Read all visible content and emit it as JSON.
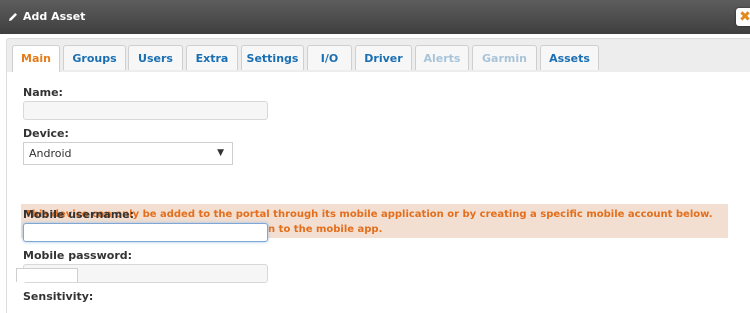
{
  "window": {
    "title": "Add Asset",
    "close_icon": "close-icon"
  },
  "tabs": [
    {
      "label": "Main",
      "state": "active"
    },
    {
      "label": "Groups",
      "state": "normal"
    },
    {
      "label": "Users",
      "state": "normal"
    },
    {
      "label": "Extra",
      "state": "normal"
    },
    {
      "label": "Settings",
      "state": "normal"
    },
    {
      "label": "I/O",
      "state": "normal"
    },
    {
      "label": "Driver",
      "state": "normal"
    },
    {
      "label": "Alerts",
      "state": "disabled"
    },
    {
      "label": "Garmin",
      "state": "disabled"
    },
    {
      "label": "Assets",
      "state": "normal"
    }
  ],
  "form": {
    "name": {
      "label": "Name:",
      "value": ""
    },
    "device": {
      "label": "Device:",
      "value": "Android"
    },
    "notice": "This device can only be added to the portal through its mobile application or by creating a specific mobile account below. Once created, use those credentials to login to the mobile app.",
    "mobile_username": {
      "label": "Mobile username:",
      "value": ""
    },
    "mobile_password": {
      "label": "Mobile password:",
      "value": ""
    },
    "sensitivity": {
      "label": "Sensitivity:",
      "value": ""
    }
  },
  "colors": {
    "accent": "#e47c1a",
    "link": "#1a6fb3",
    "notice_bg": "#f2dfd1",
    "titlebar": "#4a4a4a"
  }
}
